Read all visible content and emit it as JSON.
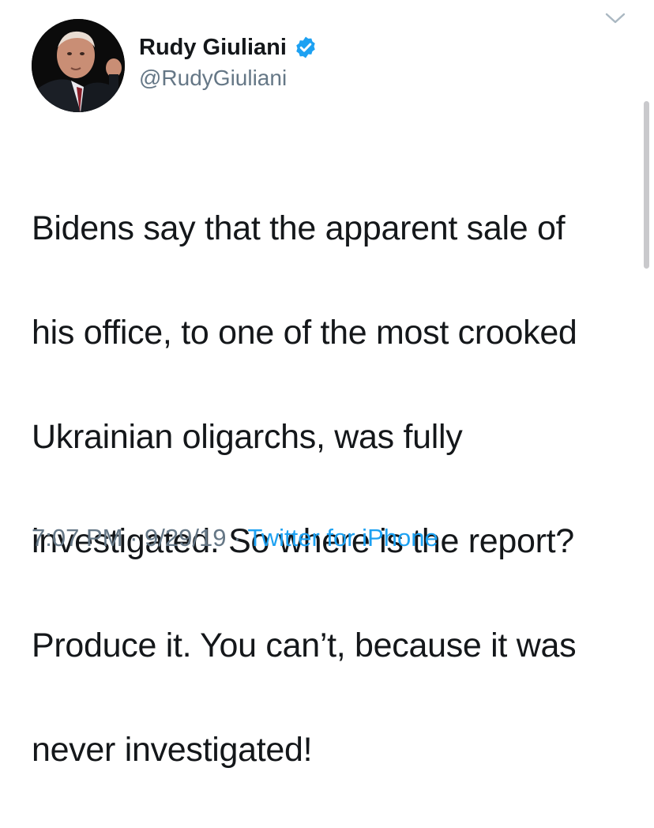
{
  "user": {
    "display_name": "Rudy Giuliani",
    "handle": "@RudyGiuliani",
    "verified": true
  },
  "tweet": {
    "text_lines": [
      "Bidens say that the apparent sale of",
      "his office, to one of the most crooked",
      "Ukrainian oligarchs, was fully",
      "investigated. So where is the report?",
      "Produce it. You can’t, because it was",
      "never investigated!"
    ],
    "time": "7:07 PM",
    "date": "9/29/19",
    "separator": "·",
    "source": "Twitter for iPhone"
  },
  "icons": {
    "verified": "verified-badge-icon",
    "menu": "chevron-down-icon"
  },
  "colors": {
    "text": "#14171a",
    "secondary": "#657786",
    "link": "#1da1f2",
    "verified": "#1da1f2"
  }
}
